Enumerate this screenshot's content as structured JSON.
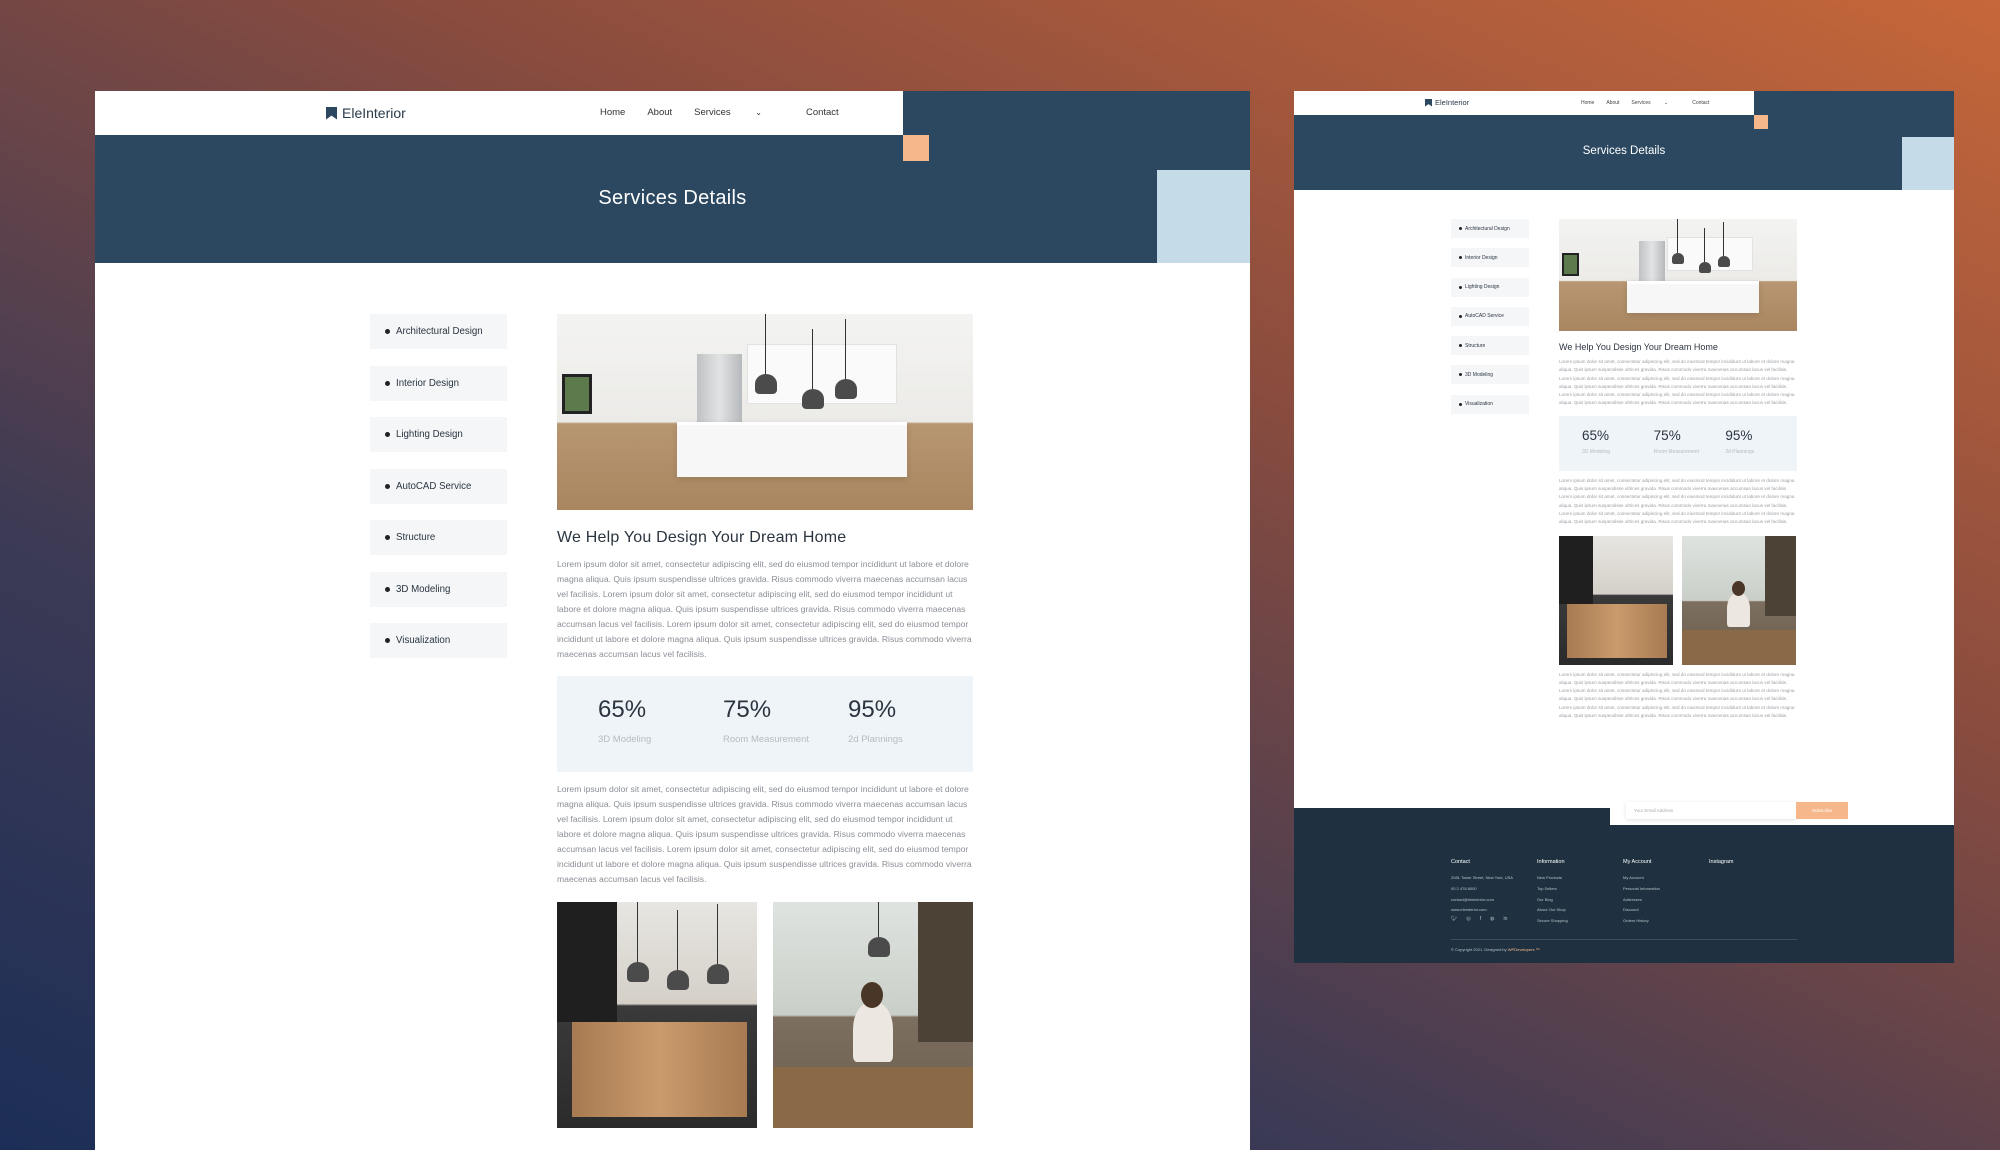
{
  "brand": {
    "name": "EleInterior"
  },
  "nav": {
    "home": "Home",
    "about": "About",
    "services": "Services",
    "contact": "Contact"
  },
  "hero": {
    "title": "Services Details"
  },
  "sidebar": {
    "items": [
      {
        "label": "Architectural Design"
      },
      {
        "label": "Interior Design"
      },
      {
        "label": "Lighting Design"
      },
      {
        "label": "AutoCAD Service"
      },
      {
        "label": "Structure"
      },
      {
        "label": "3D Modeling"
      },
      {
        "label": "Visualization"
      }
    ]
  },
  "main": {
    "heading": "We Help You Design Your Dream Home",
    "paragraph": "Lorem ipsum dolor sit amet, consectetur adipiscing elit, sed do eiusmod tempor incididunt ut labore et dolore magna aliqua. Quis ipsum suspendisse ultrices gravida. Risus commodo viverra maecenas accumsan lacus vel facilisis. Lorem ipsum dolor sit amet, consectetur adipiscing elit, sed do eiusmod tempor incididunt ut labore et dolore magna aliqua. Quis ipsum suspendisse ultrices gravida. Risus commodo viverra maecenas accumsan lacus vel facilisis. Lorem ipsum dolor sit amet, consectetur adipiscing elit, sed do eiusmod tempor incididunt ut labore et dolore magna aliqua. Quis ipsum suspendisse ultrices gravida. Risus commodo viverra maecenas accumsan lacus vel facilisis.",
    "stats": [
      {
        "value": "65%",
        "label": "3D Modeling"
      },
      {
        "value": "75%",
        "label": "Room Measurement"
      },
      {
        "value": "95%",
        "label": "2d Plannings"
      }
    ]
  },
  "newsletter": {
    "placeholder": "Your Email Address",
    "button": "Subscribe"
  },
  "footer": {
    "contact": {
      "heading": "Contact",
      "lines": [
        "2081 Tower Street, New York, USA",
        "00 2 478 8000",
        "contact@eleinterior.com",
        "www.eleinterior.com"
      ]
    },
    "information": {
      "heading": "Information",
      "lines": [
        "New Products",
        "Top Sellers",
        "Our Blog",
        "About Our Shop",
        "Secure Shopping"
      ]
    },
    "account": {
      "heading": "My Account",
      "lines": [
        "My Account",
        "Personal Information",
        "Addresses",
        "Discount",
        "Orders History"
      ]
    },
    "instagram": {
      "heading": "Instagram"
    },
    "social_icons": [
      "twitter-icon",
      "instagram-icon",
      "facebook-icon",
      "dribbble-icon",
      "linkedin-icon"
    ],
    "copyright_prefix": "© Copyright 2021. Designed by ",
    "copyright_brand": "WPDevelopers ™"
  },
  "colors": {
    "navy": "#2c4860",
    "peach": "#f6b88a",
    "light_blue": "#c5dbe8",
    "footer": "#1f3140"
  }
}
